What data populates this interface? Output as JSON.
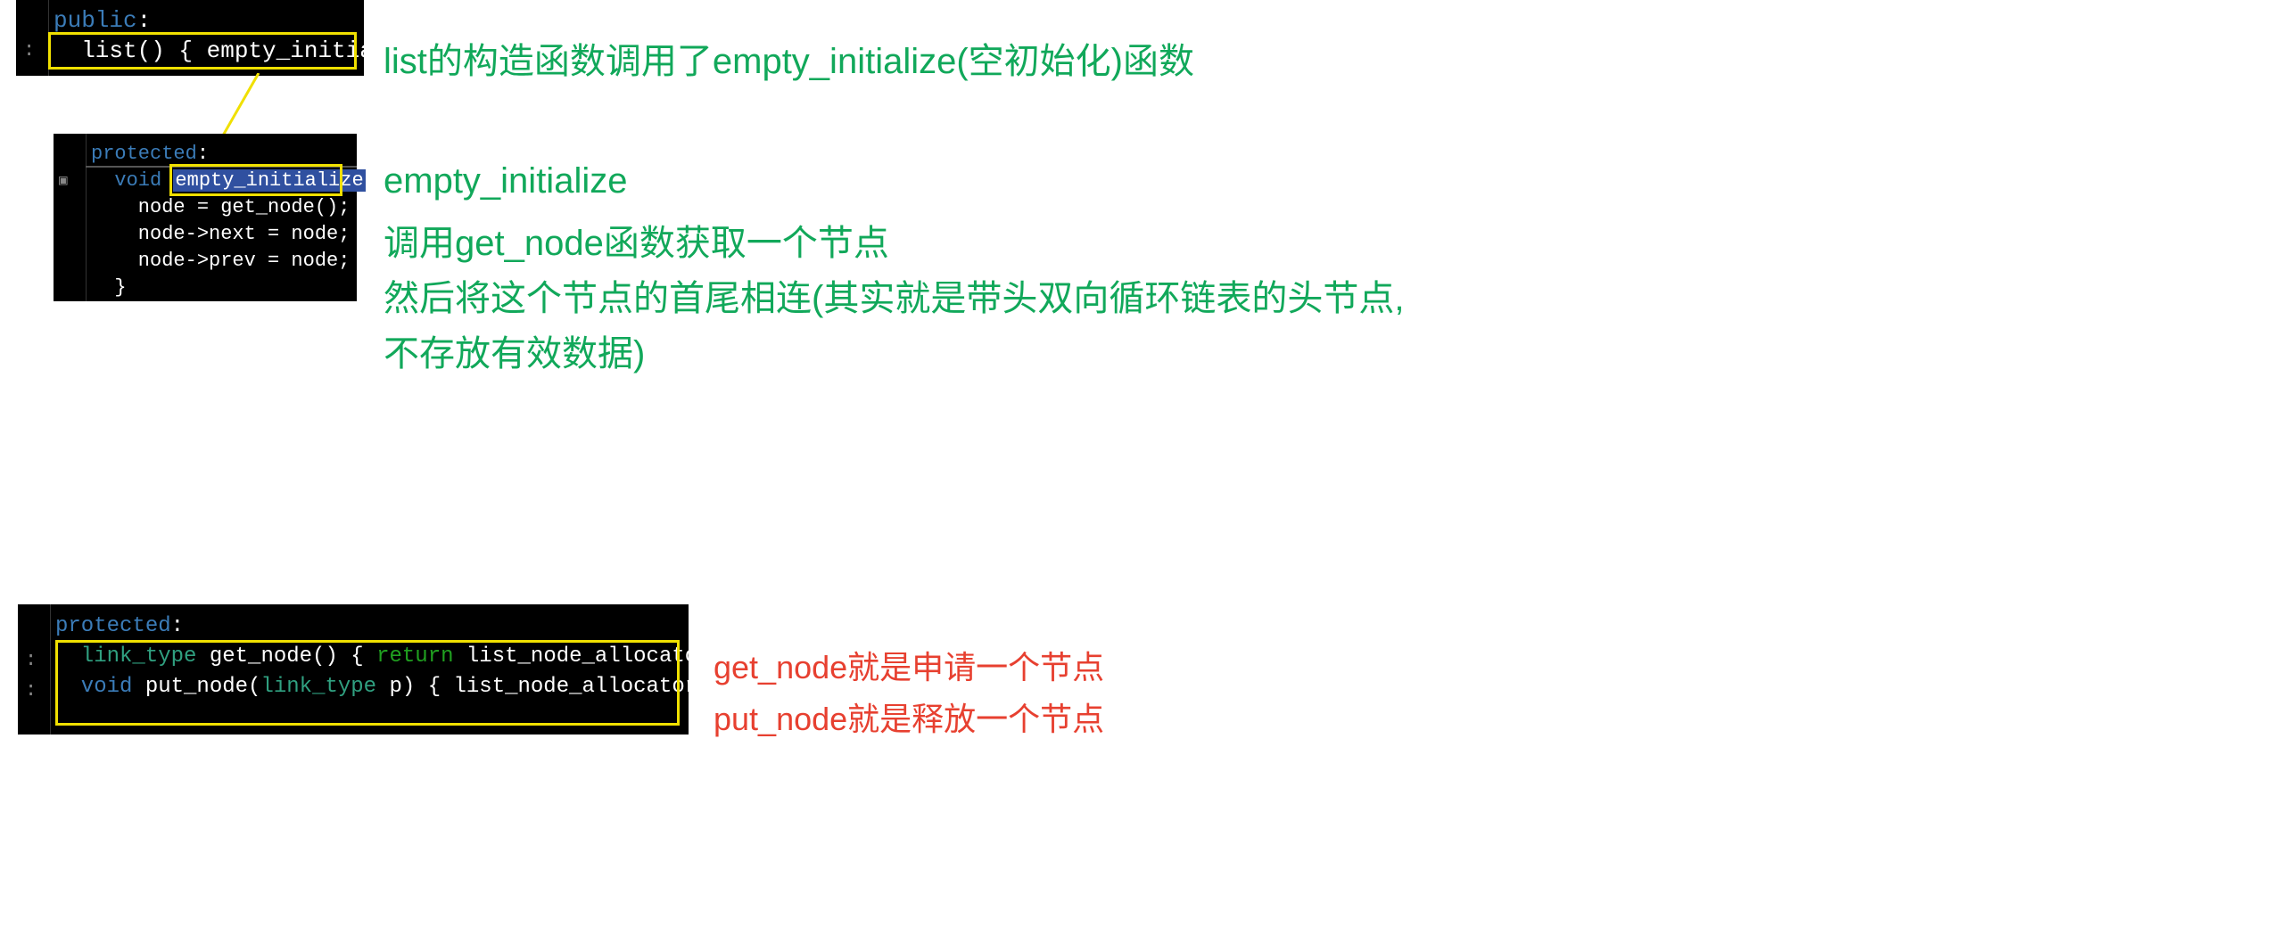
{
  "box1": {
    "access": "public",
    "code_line": "  list() { empty_initialize(); }"
  },
  "box2": {
    "access": "protected",
    "l1_pre": "  void ",
    "l1_hl": "empty_initialize",
    "l1_post": "() {",
    "l2": "    node = get_node();",
    "l3": "    node->next = node;",
    "l4": "    node->prev = node;",
    "l5": "  }"
  },
  "box3": {
    "access": "protected",
    "l1_type": "  link_type",
    "l1_name": " get_node() { ",
    "l1_ret": "return",
    "l1_rest": " list_node_allocator::allocate(); }",
    "l2_void": "  void",
    "l2_name": " put_node(",
    "l2_type": "link_type",
    "l2_rest": " p) { list_node_allocator::deallocate(p); }"
  },
  "annotations": {
    "a1": "list的构造函数调用了empty_initialize(空初始化)函数",
    "a2_title": "empty_initialize",
    "a2_l1": "调用get_node函数获取一个节点",
    "a2_l2": "然后将这个节点的首尾相连(其实就是带头双向循环链表的头节点,",
    "a2_l3": "不存放有效数据)",
    "a3_l1": "get_node就是申请一个节点",
    "a3_l2": "put_node就是释放一个节点"
  }
}
